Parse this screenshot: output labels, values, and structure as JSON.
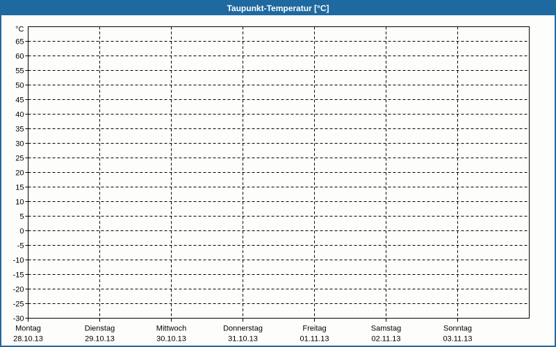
{
  "window": {
    "title": "Taupunkt-Temperatur [°C]",
    "colors": {
      "title_bar": "#1e69a0",
      "title_text": "#ffffff",
      "window_border": "#1e69a0",
      "background": "#fdfdfb",
      "plot_border": "#000000",
      "grid_line": "#000000",
      "label_text": "#000000"
    }
  },
  "chart_data": {
    "type": "line",
    "title": "Taupunkt-Temperatur [°C]",
    "grid": "dashed",
    "legend": "none",
    "y_axis": {
      "unit_label": "°C",
      "min": -30,
      "max": 70,
      "tick_step": 5,
      "tick_labels": [
        65,
        60,
        55,
        50,
        45,
        40,
        35,
        30,
        25,
        20,
        15,
        10,
        5,
        0,
        -5,
        -10,
        -15,
        -20,
        -25,
        -30
      ]
    },
    "x_axis": {
      "categories": [
        {
          "weekday": "Montag",
          "date": "28.10.13"
        },
        {
          "weekday": "Dienstag",
          "date": "29.10.13"
        },
        {
          "weekday": "Mittwoch",
          "date": "30.10.13"
        },
        {
          "weekday": "Donnerstag",
          "date": "31.10.13"
        },
        {
          "weekday": "Freitag",
          "date": "01.11.13"
        },
        {
          "weekday": "Samstag",
          "date": "02.11.13"
        },
        {
          "weekday": "Sonntag",
          "date": "03.11.13"
        }
      ]
    },
    "series": []
  }
}
